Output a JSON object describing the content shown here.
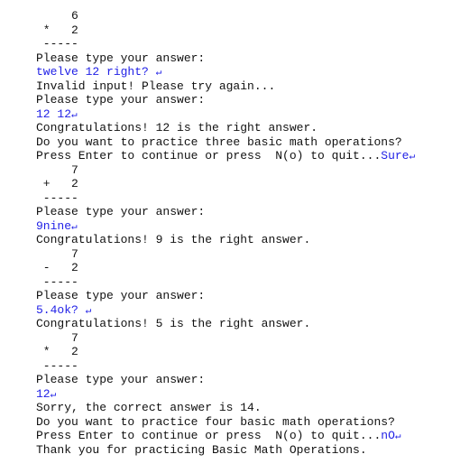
{
  "colors": {
    "text": "#111111",
    "user_input": "#1f1fe6"
  },
  "lines": [
    {
      "text": "     6",
      "input": "",
      "enter": false
    },
    {
      "text": " *   2",
      "input": "",
      "enter": false
    },
    {
      "text": " -----",
      "input": "",
      "enter": false
    },
    {
      "text": "Please type your answer:",
      "input": "",
      "enter": false
    },
    {
      "text": "",
      "input": "twelve 12 right? ",
      "enter": true
    },
    {
      "text": "Invalid input! Please try again...",
      "input": "",
      "enter": false
    },
    {
      "text": "Please type your answer:",
      "input": "",
      "enter": false
    },
    {
      "text": "",
      "input": "12 12",
      "enter": true
    },
    {
      "text": "Congratulations! 12 is the right answer.",
      "input": "",
      "enter": false
    },
    {
      "text": "Do you want to practice three basic math operations?",
      "input": "",
      "enter": false
    },
    {
      "text": "Press Enter to continue or press  N(o) to quit...",
      "input": "Sure",
      "enter": true
    },
    {
      "text": "     7",
      "input": "",
      "enter": false
    },
    {
      "text": " +   2",
      "input": "",
      "enter": false
    },
    {
      "text": " -----",
      "input": "",
      "enter": false
    },
    {
      "text": "Please type your answer:",
      "input": "",
      "enter": false
    },
    {
      "text": "",
      "input": "9nine",
      "enter": true
    },
    {
      "text": "Congratulations! 9 is the right answer.",
      "input": "",
      "enter": false
    },
    {
      "text": "     7",
      "input": "",
      "enter": false
    },
    {
      "text": " -   2",
      "input": "",
      "enter": false
    },
    {
      "text": " -----",
      "input": "",
      "enter": false
    },
    {
      "text": "Please type your answer:",
      "input": "",
      "enter": false
    },
    {
      "text": "",
      "input": "5.4ok? ",
      "enter": true
    },
    {
      "text": "Congratulations! 5 is the right answer.",
      "input": "",
      "enter": false
    },
    {
      "text": "     7",
      "input": "",
      "enter": false
    },
    {
      "text": " *   2",
      "input": "",
      "enter": false
    },
    {
      "text": " -----",
      "input": "",
      "enter": false
    },
    {
      "text": "Please type your answer:",
      "input": "",
      "enter": false
    },
    {
      "text": "",
      "input": "12",
      "enter": true
    },
    {
      "text": "Sorry, the correct answer is 14.",
      "input": "",
      "enter": false
    },
    {
      "text": "Do you want to practice four basic math operations?",
      "input": "",
      "enter": false
    },
    {
      "text": "Press Enter to continue or press  N(o) to quit...",
      "input": "nO",
      "enter": true
    },
    {
      "text": "Thank you for practicing Basic Math Operations.",
      "input": "",
      "enter": false
    }
  ],
  "enter_glyph": "↵"
}
